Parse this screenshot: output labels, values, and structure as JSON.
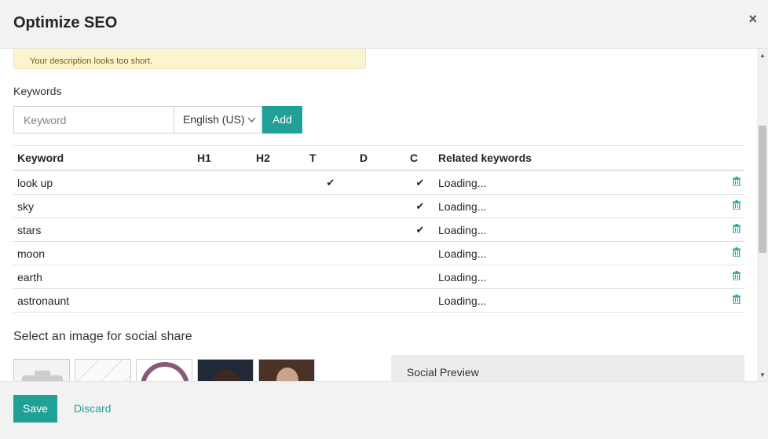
{
  "dialog": {
    "title": "Optimize SEO",
    "close_glyph": "×"
  },
  "alert": {
    "text": "Your description looks too short."
  },
  "keywords": {
    "label": "Keywords",
    "input_placeholder": "Keyword",
    "language": "English (US)",
    "add_label": "Add"
  },
  "table": {
    "headers": [
      "Keyword",
      "H1",
      "H2",
      "T",
      "D",
      "C",
      "Related keywords"
    ],
    "rows": [
      {
        "keyword": "look up",
        "h1": "",
        "h2": "",
        "t": "✔",
        "d": "",
        "c": "✔",
        "related": "Loading..."
      },
      {
        "keyword": "sky",
        "h1": "",
        "h2": "",
        "t": "",
        "d": "",
        "c": "✔",
        "related": "Loading..."
      },
      {
        "keyword": "stars",
        "h1": "",
        "h2": "",
        "t": "",
        "d": "",
        "c": "✔",
        "related": "Loading..."
      },
      {
        "keyword": "moon",
        "h1": "",
        "h2": "",
        "t": "",
        "d": "",
        "c": "",
        "related": "Loading..."
      },
      {
        "keyword": "earth",
        "h1": "",
        "h2": "",
        "t": "",
        "d": "",
        "c": "",
        "related": "Loading..."
      },
      {
        "keyword": "astronaunt",
        "h1": "",
        "h2": "",
        "t": "",
        "d": "",
        "c": "",
        "related": "Loading..."
      }
    ]
  },
  "social": {
    "select_title": "Select an image for social share",
    "preview_title": "Social Preview"
  },
  "footer": {
    "save_label": "Save",
    "discard_label": "Discard"
  },
  "colors": {
    "accent": "#21a097",
    "alert_bg": "#fcf3cf"
  },
  "icons": {
    "check": "check-icon",
    "delete": "trash-icon",
    "close": "close-icon",
    "dropdown": "chevron-down-icon"
  }
}
